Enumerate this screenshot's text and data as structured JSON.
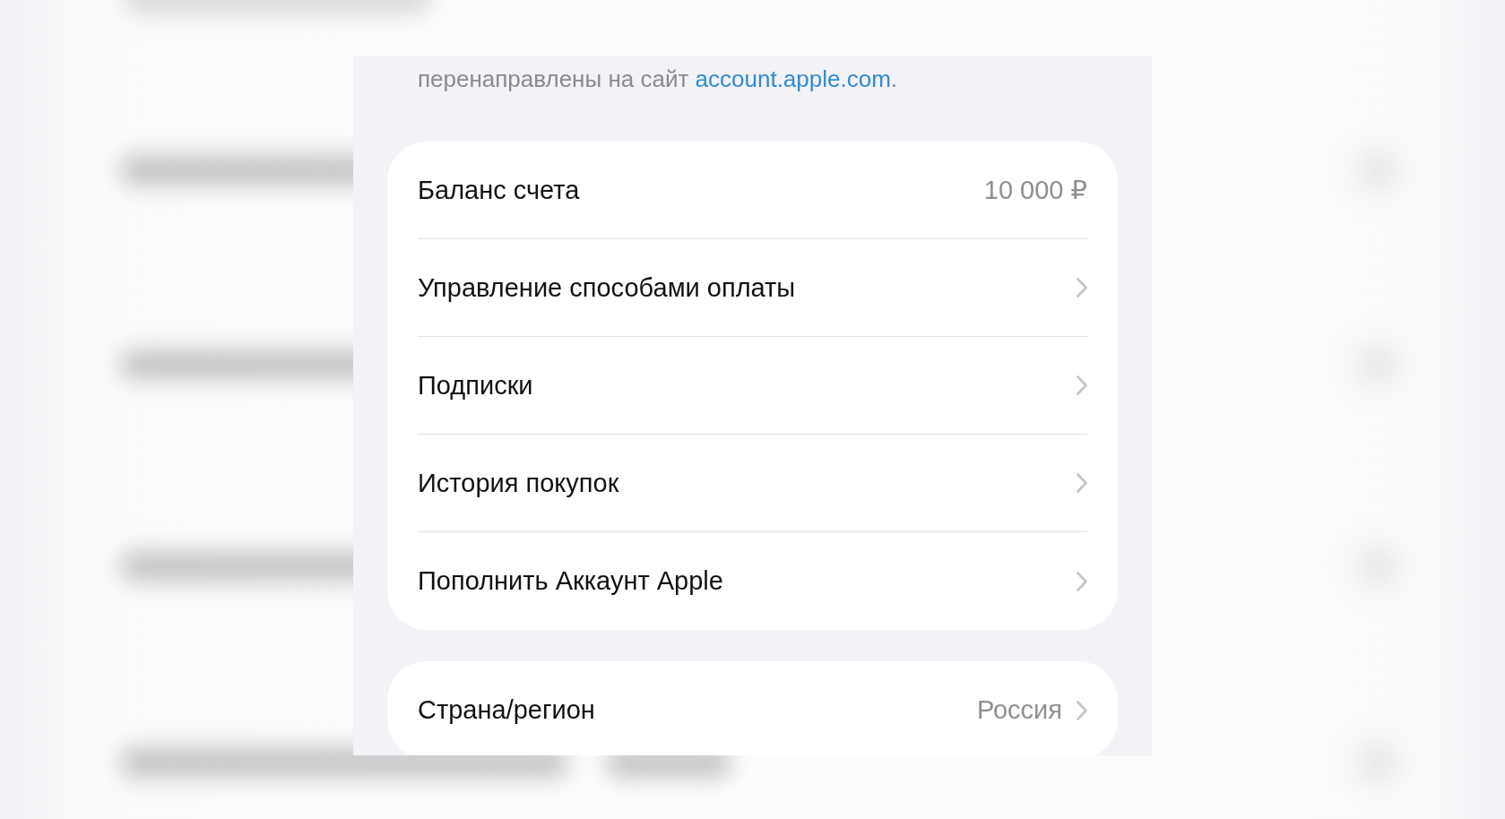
{
  "note": {
    "text": "перенаправлены на сайт ",
    "link": "account.apple.com",
    "trail": "."
  },
  "account_card": {
    "rows": [
      {
        "kind": "info",
        "label": "Баланс счета",
        "value": "10 000 ₽"
      },
      {
        "kind": "nav",
        "label": "Управление способами оплаты"
      },
      {
        "kind": "nav",
        "label": "Подписки"
      },
      {
        "kind": "nav",
        "label": "История покупок"
      },
      {
        "kind": "nav",
        "label": "Пополнить Аккаунт Apple"
      }
    ]
  },
  "region_card": {
    "rows": [
      {
        "kind": "nav",
        "label": "Страна/регион",
        "value": "Россия"
      }
    ]
  }
}
